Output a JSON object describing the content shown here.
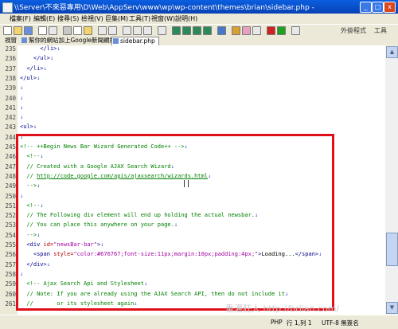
{
  "window": {
    "title": "\\\\Server\\不來惡專用\\D\\Web\\AppServ\\www\\wp\\wp-content\\themes\\brian\\sidebar.php - EmEditor",
    "min_label": "_",
    "max_label": "□",
    "close_label": "x"
  },
  "menubar": {
    "items": [
      "檔案(F)",
      "編輯(E)",
      "搜尋(S)",
      "檢視(V)",
      "巨集(M)",
      "工具(T)",
      "視窗(W)",
      "說明(H)"
    ]
  },
  "toolbar": {
    "right_labels": [
      "外掛程式",
      "工具"
    ]
  },
  "tabs": [
    {
      "label": "視窗"
    },
    {
      "label": "幫你的網站加上Google新聞顯播 .txt"
    },
    {
      "label": "sidebar.php"
    }
  ],
  "code_lines": [
    {
      "num": "235",
      "segs": [
        {
          "t": "      ",
          "c": ""
        },
        {
          "t": "</li>",
          "c": "blue"
        },
        {
          "t": "↓",
          "c": "nl"
        }
      ]
    },
    {
      "num": "236",
      "segs": [
        {
          "t": "    ",
          "c": ""
        },
        {
          "t": "</ul>",
          "c": "blue"
        },
        {
          "t": "↓",
          "c": "nl"
        }
      ]
    },
    {
      "num": "237",
      "segs": [
        {
          "t": "  ",
          "c": ""
        },
        {
          "t": "</li>",
          "c": "blue"
        },
        {
          "t": "↓",
          "c": "nl"
        }
      ]
    },
    {
      "num": "238",
      "segs": [
        {
          "t": "</ul>",
          "c": "blue"
        },
        {
          "t": "↓",
          "c": "nl"
        }
      ]
    },
    {
      "num": "239",
      "segs": [
        {
          "t": "↓",
          "c": "nl"
        }
      ]
    },
    {
      "num": "240",
      "segs": [
        {
          "t": "↓",
          "c": "nl"
        }
      ]
    },
    {
      "num": "241",
      "segs": [
        {
          "t": "↓",
          "c": "nl"
        }
      ]
    },
    {
      "num": "242",
      "segs": [
        {
          "t": "↓",
          "c": "nl"
        }
      ]
    },
    {
      "num": "243",
      "segs": [
        {
          "t": "<ul>",
          "c": "blue"
        },
        {
          "t": "↓",
          "c": "nl"
        }
      ]
    },
    {
      "num": "244",
      "segs": [
        {
          "t": "↓",
          "c": "nl"
        }
      ]
    },
    {
      "num": "245",
      "segs": [
        {
          "t": "<!-- ++Begin News Bar Wizard Generated Code++ -->",
          "c": "green"
        },
        {
          "t": "↓",
          "c": "nl"
        }
      ]
    },
    {
      "num": "246",
      "segs": [
        {
          "t": "  <!--",
          "c": "green"
        },
        {
          "t": "↓",
          "c": "nl"
        }
      ]
    },
    {
      "num": "247",
      "segs": [
        {
          "t": "  // Created with a Google AJAX Search Wizard",
          "c": "green"
        },
        {
          "t": "↓",
          "c": "nl"
        }
      ]
    },
    {
      "num": "248",
      "segs": [
        {
          "t": "  // ",
          "c": "green"
        },
        {
          "t": "http://code.google.com/apis/ajaxsearch/wizards.html",
          "c": "link"
        },
        {
          "t": "↓",
          "c": "nl"
        }
      ]
    },
    {
      "num": "249",
      "segs": [
        {
          "t": "  -->",
          "c": "green"
        },
        {
          "t": "↓",
          "c": "nl"
        }
      ]
    },
    {
      "num": "250",
      "segs": [
        {
          "t": "↓",
          "c": "nl"
        }
      ]
    },
    {
      "num": "251",
      "segs": [
        {
          "t": "  <!--",
          "c": "green"
        },
        {
          "t": "↓",
          "c": "nl"
        }
      ]
    },
    {
      "num": "252",
      "segs": [
        {
          "t": "  // The Following div element will end up holding the actual newsbar.",
          "c": "green"
        },
        {
          "t": "↓",
          "c": "nl"
        }
      ]
    },
    {
      "num": "253",
      "segs": [
        {
          "t": "  // You can place this anywhere on your page.",
          "c": "green"
        },
        {
          "t": "↓",
          "c": "nl"
        }
      ]
    },
    {
      "num": "254",
      "segs": [
        {
          "t": "  -->",
          "c": "green"
        },
        {
          "t": "↓",
          "c": "nl"
        }
      ]
    },
    {
      "num": "255",
      "segs": [
        {
          "t": "  <div ",
          "c": "blue"
        },
        {
          "t": "id=",
          "c": "red"
        },
        {
          "t": "\"newsBar-bar\"",
          "c": "purple"
        },
        {
          "t": ">",
          "c": "blue"
        },
        {
          "t": "↓",
          "c": "nl"
        }
      ]
    },
    {
      "num": "256",
      "segs": [
        {
          "t": "    <span ",
          "c": "blue"
        },
        {
          "t": "style=",
          "c": "red"
        },
        {
          "t": "\"color:#676767;font-size:11px;margin:10px;padding:4px;\"",
          "c": "purple"
        },
        {
          "t": ">",
          "c": "blue"
        },
        {
          "t": "Loading...",
          "c": ""
        },
        {
          "t": "</span>",
          "c": "blue"
        },
        {
          "t": "↓",
          "c": "nl"
        }
      ]
    },
    {
      "num": "257",
      "segs": [
        {
          "t": "  </div>",
          "c": "blue"
        },
        {
          "t": "↓",
          "c": "nl"
        }
      ]
    },
    {
      "num": "258",
      "segs": [
        {
          "t": "↓",
          "c": "nl"
        }
      ]
    },
    {
      "num": "259",
      "segs": [
        {
          "t": "  <!-- Ajax Search Api and Stylesheet",
          "c": "green"
        },
        {
          "t": "↓",
          "c": "nl"
        }
      ]
    },
    {
      "num": "260",
      "segs": [
        {
          "t": "  // Note: If you are already using the AJAX Search API, then do not include it",
          "c": "green"
        },
        {
          "t": "↓",
          "c": "nl"
        }
      ]
    },
    {
      "num": "261",
      "segs": [
        {
          "t": "  //       or its stylesheet again",
          "c": "green"
        },
        {
          "t": "↓",
          "c": "nl"
        }
      ]
    }
  ],
  "watermark": "重灌狂人  http://briian.com/",
  "status": {
    "mode": "PHP",
    "position": "行 1,列 1",
    "encoding": "UTF-8 無簽名"
  },
  "colors": {
    "highlight_box": "#e0101a",
    "tag": "#00008b",
    "comment": "#008000"
  }
}
